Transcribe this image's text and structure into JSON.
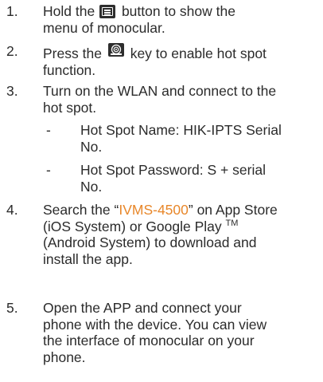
{
  "steps": [
    {
      "number": "1.",
      "line1_before": "Hold the",
      "line1_after": "button to show the",
      "line2": "menu of monocular.",
      "icon": "menu-button-icon"
    },
    {
      "number": "2.",
      "line1_before": "Press the",
      "line1_after": "key to enable hot spot",
      "line2": "function.",
      "icon": "hotspot-key-icon"
    },
    {
      "number": "3.",
      "line1": "Turn on the WLAN and connect to the",
      "line2": "hot spot.",
      "subitems": [
        {
          "dash": "-",
          "line1": "Hot Spot Name: HIK-IPTS Serial",
          "line2": "No."
        },
        {
          "dash": "-",
          "line1": "Hot Spot Password: S + serial",
          "line2": "No."
        }
      ]
    },
    {
      "number": "4.",
      "line1_open_quote": "Search the “",
      "app_name": "IVMS-4500",
      "line1_close": "” on App Store",
      "line2": "(iOS System) or Google Play",
      "trademark": "TM",
      "line3": "(Android System) to download and",
      "line4": "install the app."
    },
    {
      "number": "5.",
      "line1": "Open the APP and connect your",
      "line2": "phone with the device. You can view",
      "line3": "the interface of monocular on your",
      "line4": "phone."
    }
  ],
  "colors": {
    "text": "#2b2b2b",
    "accent": "#e8872a",
    "icon_bg": "#2e2e2e"
  }
}
